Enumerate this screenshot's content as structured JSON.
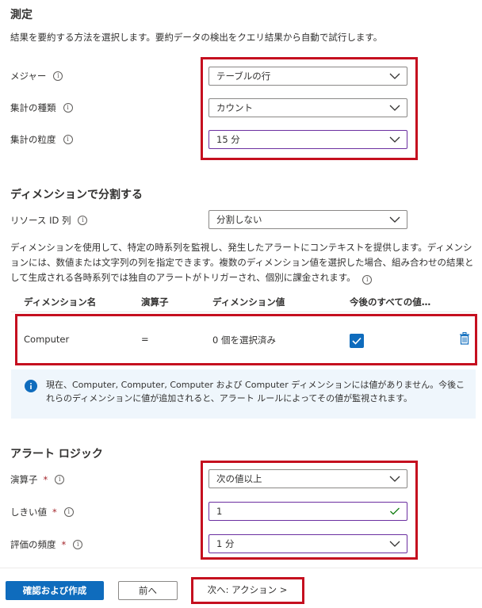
{
  "measure": {
    "title": "測定",
    "description": "結果を要約する方法を選択します。要約データの検出をクエリ結果から自動で試行します。",
    "measure_label": "メジャー",
    "measure_value": "テーブルの行",
    "aggregation_type_label": "集計の種類",
    "aggregation_type_value": "カウント",
    "granularity_label": "集計の粒度",
    "granularity_value": "15 分"
  },
  "split": {
    "title": "ディメンションで分割する",
    "resource_id_label": "リソース ID 列",
    "resource_id_value": "分割しない",
    "description": "ディメンションを使用して、特定の時系列を監視し、発生したアラートにコンテキストを提供します。ディメンションには、数値または文字列の列を指定できます。複数のディメンション値を選択した場合、組み合わせの結果として生成される各時系列では独自のアラートがトリガーされ、個別に課金されます。",
    "table": {
      "headers": [
        "ディメンション名",
        "演算子",
        "ディメンション値",
        "今後のすべての値…"
      ],
      "rows": [
        {
          "name": "Computer",
          "operator": "=",
          "value": "0 個を選択済み",
          "future": true
        }
      ]
    },
    "info_message": "現在、Computer, Computer, Computer および Computer ディメンションには値がありません。今後これらのディメンションに値が追加されると、アラート ルールによってその値が監視されます。"
  },
  "alert_logic": {
    "title": "アラート ロジック",
    "operator_label": "演算子",
    "operator_value": "次の値以上",
    "threshold_label": "しきい値",
    "threshold_value": "1",
    "frequency_label": "評価の頻度",
    "frequency_value": "1 分",
    "required_mark": "*"
  },
  "footer": {
    "review_create": "確認および作成",
    "previous": "前へ",
    "next": "次へ: アクション >"
  },
  "colors": {
    "accent": "#0f6cbd",
    "highlight": "#c50f1f",
    "selected_border": "#6b2fa0",
    "valid": "#107c10",
    "info_bg": "#eff6fc"
  }
}
